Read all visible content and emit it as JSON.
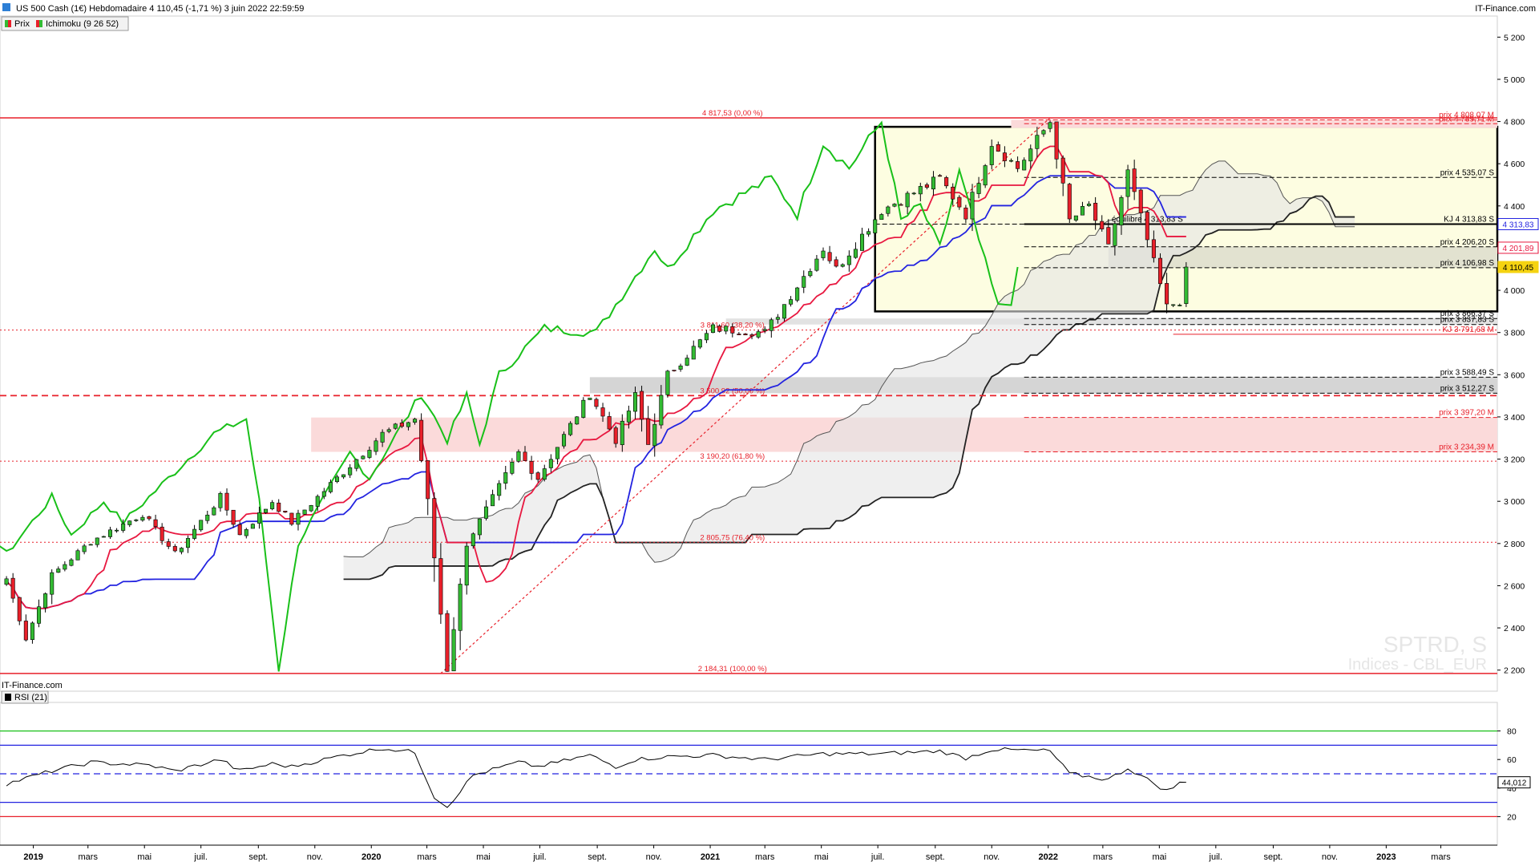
{
  "header": {
    "title": "US 500 Cash (1€) Hebdomadaire 4 110,45 (-1,71 %) 3 juin 2022 22:59:59",
    "brand": "IT-Finance.com",
    "legend_price": "Prix",
    "legend_ichimoku": "Ichimoku (9 26 52)"
  },
  "watermark": {
    "symbol": "SPTRD, S",
    "market": "Indices - CBL_EUR"
  },
  "footer_brand": "IT-Finance.com",
  "rsi_panel": {
    "legend": "RSI (21)",
    "current_label": "44,012"
  },
  "colors": {
    "bull": "#33bb33",
    "bear": "#e8202a",
    "tenkan": "#e81840",
    "kijun": "#2323e0",
    "chikou": "#19c019",
    "ssb": "#222222",
    "ssa": "#555555",
    "box_fill": "#fdfde1",
    "red_zone": "#fbdada",
    "grey_zone": "#d5d5d5"
  },
  "chart_data": [
    {
      "type": "candlestick",
      "title": "US 500 Cash (1€) Hebdomadaire 4 110,45 (-1,71 %) 3 juin 2022 22:59:59",
      "timeframe": "weekly",
      "x_range": [
        "2018-11-26",
        "2023-05-01"
      ],
      "ylim": [
        2100,
        5300
      ],
      "y_ticks": [
        2200,
        2400,
        2600,
        2800,
        3000,
        3200,
        3400,
        3600,
        3800,
        4000,
        4200,
        4400,
        4600,
        4800,
        5000,
        5200
      ],
      "y_tick_labels": [
        "2 200",
        "2 400",
        "2 600",
        "2 800",
        "3 000",
        "3 200",
        "3 400",
        "3 600",
        "3 800",
        "4 000",
        "4 200",
        "4 400",
        "4 600",
        "4 800",
        "5 000",
        "5 200"
      ],
      "x_ticks": [
        {
          "date": "2019-01-01",
          "label": "2019"
        },
        {
          "date": "2019-03-01",
          "label": "mars"
        },
        {
          "date": "2019-05-01",
          "label": "mai"
        },
        {
          "date": "2019-07-01",
          "label": "juil."
        },
        {
          "date": "2019-09-01",
          "label": "sept."
        },
        {
          "date": "2019-11-01",
          "label": "nov."
        },
        {
          "date": "2020-01-01",
          "label": "2020"
        },
        {
          "date": "2020-03-01",
          "label": "mars"
        },
        {
          "date": "2020-05-01",
          "label": "mai"
        },
        {
          "date": "2020-07-01",
          "label": "juil."
        },
        {
          "date": "2020-09-01",
          "label": "sept."
        },
        {
          "date": "2020-11-01",
          "label": "nov."
        },
        {
          "date": "2021-01-01",
          "label": "2021"
        },
        {
          "date": "2021-03-01",
          "label": "mars"
        },
        {
          "date": "2021-05-01",
          "label": "mai"
        },
        {
          "date": "2021-07-01",
          "label": "juil."
        },
        {
          "date": "2021-09-01",
          "label": "sept."
        },
        {
          "date": "2021-11-01",
          "label": "nov."
        },
        {
          "date": "2022-01-01",
          "label": "2022"
        },
        {
          "date": "2022-03-01",
          "label": "mars"
        },
        {
          "date": "2022-05-01",
          "label": "mai"
        },
        {
          "date": "2022-07-01",
          "label": "juil."
        },
        {
          "date": "2022-09-01",
          "label": "sept."
        },
        {
          "date": "2022-11-01",
          "label": "nov."
        },
        {
          "date": "2023-01-01",
          "label": "2023"
        },
        {
          "date": "2023-03-01",
          "label": "mars"
        }
      ],
      "price_anchors": [
        [
          "2018-12-03",
          2633
        ],
        [
          "2018-12-24",
          2350
        ],
        [
          "2019-01-21",
          2650
        ],
        [
          "2019-03-04",
          2810
        ],
        [
          "2019-04-29",
          2940
        ],
        [
          "2019-06-03",
          2750
        ],
        [
          "2019-07-22",
          3020
        ],
        [
          "2019-08-12",
          2840
        ],
        [
          "2019-09-16",
          3000
        ],
        [
          "2019-10-07",
          2900
        ],
        [
          "2019-12-02",
          3140
        ],
        [
          "2020-01-13",
          3320
        ],
        [
          "2020-02-17",
          3390
        ],
        [
          "2020-03-02",
          3000
        ],
        [
          "2020-03-23",
          2200
        ],
        [
          "2020-04-13",
          2800
        ],
        [
          "2020-06-08",
          3230
        ],
        [
          "2020-06-29",
          3110
        ],
        [
          "2020-08-24",
          3510
        ],
        [
          "2020-09-21",
          3290
        ],
        [
          "2020-10-12",
          3500
        ],
        [
          "2020-10-26",
          3270
        ],
        [
          "2020-11-16",
          3600
        ],
        [
          "2021-01-04",
          3820
        ],
        [
          "2021-03-01",
          3800
        ],
        [
          "2021-05-03",
          4200
        ],
        [
          "2021-05-17",
          4100
        ],
        [
          "2021-07-05",
          4380
        ],
        [
          "2021-09-06",
          4530
        ],
        [
          "2021-10-04",
          4360
        ],
        [
          "2021-11-01",
          4700
        ],
        [
          "2021-11-29",
          4580
        ],
        [
          "2022-01-03",
          4800
        ],
        [
          "2022-01-24",
          4330
        ],
        [
          "2022-02-14",
          4400
        ],
        [
          "2022-03-07",
          4200
        ],
        [
          "2022-03-28",
          4560
        ],
        [
          "2022-04-25",
          4130
        ],
        [
          "2022-05-09",
          3920
        ],
        [
          "2022-05-23",
          3950
        ],
        [
          "2022-05-30",
          4158
        ],
        [
          "2022-06-03",
          4110.45
        ]
      ],
      "last_close": 4110.45,
      "change_pct": -1.71,
      "ichimoku": {
        "params": [
          9,
          26,
          52
        ],
        "kijun_last": 4313.83,
        "tenkan_last": 4201.89
      },
      "price_boxes": [
        {
          "label": "4 313,83",
          "value": 4313.83,
          "color": "#2323e0"
        },
        {
          "label": "4 201,89",
          "value": 4201.89,
          "color": "#e81840"
        },
        {
          "label": "4 110,45",
          "value": 4110.45,
          "color": "#f5d311"
        }
      ],
      "fibonacci": {
        "high": 4817.53,
        "low": 2184.31,
        "levels": [
          {
            "value": 4817.53,
            "label": "4 817,53 (0,00 %)"
          },
          {
            "value": 3811.6,
            "label": "3 811,60 (38,20 %)"
          },
          {
            "value": 3500.92,
            "label": "3 500,92 (50,00 %)"
          },
          {
            "value": 3190.2,
            "label": "3 190,20 (61,80 %)"
          },
          {
            "value": 2805.75,
            "label": "2 805,75 (76,40 %)"
          },
          {
            "value": 2184.31,
            "label": "2 184,31 (100,00 %)"
          }
        ]
      },
      "price_levels": [
        {
          "value": 4808.07,
          "label": "prix 4 808,07 M",
          "color": "#e8202a"
        },
        {
          "value": 4789.71,
          "label": "prix 4 789,71 M",
          "color": "#e8202a"
        },
        {
          "value": 4535.07,
          "label": "prix 4 535,07 S",
          "color": "#000000"
        },
        {
          "value": 4313.83,
          "label": "KJ 4 313,83 S",
          "color": "#000000"
        },
        {
          "value": 4313.83,
          "label": "équilibre 4 313,83 S",
          "color": "#000000"
        },
        {
          "value": 4206.2,
          "label": "prix 4 206,20 S",
          "color": "#000000"
        },
        {
          "value": 4106.98,
          "label": "prix 4 106,98 S",
          "color": "#000000"
        },
        {
          "value": 3866.37,
          "label": "prix 3 866,37 S",
          "color": "#000000"
        },
        {
          "value": 3837.83,
          "label": "prix 3 837,83 S",
          "color": "#000000"
        },
        {
          "value": 3791.68,
          "label": "KJ 3 791,68 M",
          "color": "#e8202a"
        },
        {
          "value": 3588.49,
          "label": "prix 3 588,49 S",
          "color": "#000000"
        },
        {
          "value": 3512.27,
          "label": "prix 3 512,27 S",
          "color": "#000000"
        },
        {
          "value": 3397.2,
          "label": "prix 3 397,20 M",
          "color": "#e8202a"
        },
        {
          "value": 3234.39,
          "label": "prix 3 234,39 M",
          "color": "#e8202a"
        }
      ]
    },
    {
      "type": "line",
      "title": "RSI (21)",
      "ylim": [
        0,
        100
      ],
      "y_ticks": [
        20,
        40,
        60,
        80
      ],
      "y_tick_labels": [
        "20",
        "40",
        "60",
        "80"
      ],
      "reference_lines": [
        80,
        70,
        50,
        30,
        20
      ],
      "current_value": 44.012,
      "anchors": [
        [
          "2018-12-03",
          43
        ],
        [
          "2019-01-21",
          52
        ],
        [
          "2019-03-04",
          58
        ],
        [
          "2019-05-06",
          56
        ],
        [
          "2019-06-03",
          52
        ],
        [
          "2019-07-22",
          60
        ],
        [
          "2019-08-12",
          52
        ],
        [
          "2019-09-16",
          57
        ],
        [
          "2019-10-07",
          55
        ],
        [
          "2019-12-02",
          63
        ],
        [
          "2020-01-13",
          68
        ],
        [
          "2020-02-17",
          65
        ],
        [
          "2020-03-09",
          34
        ],
        [
          "2020-03-23",
          27
        ],
        [
          "2020-04-20",
          49
        ],
        [
          "2020-06-08",
          58
        ],
        [
          "2020-06-29",
          55
        ],
        [
          "2020-08-24",
          63
        ],
        [
          "2020-09-21",
          55
        ],
        [
          "2020-10-12",
          60
        ],
        [
          "2020-11-16",
          62
        ],
        [
          "2021-01-04",
          63
        ],
        [
          "2021-03-01",
          60
        ],
        [
          "2021-05-03",
          64
        ],
        [
          "2021-07-05",
          64
        ],
        [
          "2021-09-06",
          66
        ],
        [
          "2021-10-04",
          61
        ],
        [
          "2021-11-01",
          67
        ],
        [
          "2022-01-03",
          66
        ],
        [
          "2022-01-24",
          50
        ],
        [
          "2022-03-07",
          46
        ],
        [
          "2022-03-28",
          54
        ],
        [
          "2022-05-09",
          38
        ],
        [
          "2022-05-30",
          46
        ],
        [
          "2022-06-03",
          44.01
        ]
      ]
    }
  ]
}
